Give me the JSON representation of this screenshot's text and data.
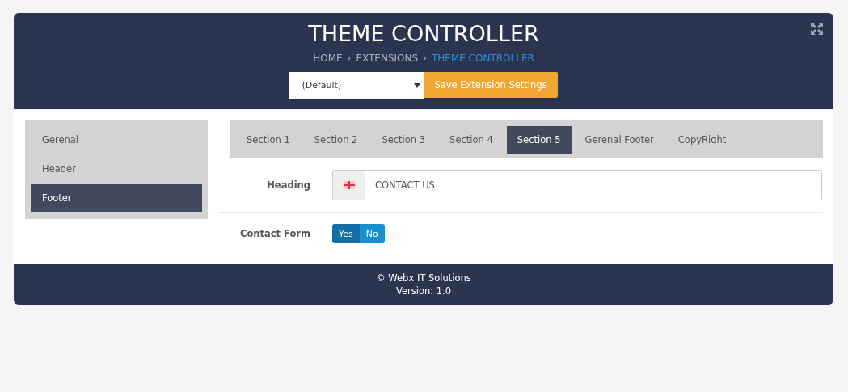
{
  "header": {
    "title": "THEME CONTROLLER",
    "breadcrumb_separator": "›",
    "breadcrumb": [
      {
        "label": "HOME",
        "current": false
      },
      {
        "label": "EXTENSIONS",
        "current": false
      },
      {
        "label": "THEME CONTROLLER",
        "current": true
      }
    ],
    "theme_select": {
      "value": "(Default)"
    },
    "save_button": "Save Extension Settings"
  },
  "sidebar": {
    "items": [
      {
        "label": "Gerenal",
        "selected": false
      },
      {
        "label": "Header",
        "selected": false
      },
      {
        "label": "Footer",
        "selected": true
      }
    ]
  },
  "tabs": [
    {
      "label": "Section 1",
      "selected": false
    },
    {
      "label": "Section 2",
      "selected": false
    },
    {
      "label": "Section 3",
      "selected": false
    },
    {
      "label": "Section 4",
      "selected": false
    },
    {
      "label": "Section 5",
      "selected": true
    },
    {
      "label": "Gerenal Footer",
      "selected": false
    },
    {
      "label": "CopyRight",
      "selected": false
    }
  ],
  "form": [
    {
      "kind": "text",
      "label": "Heading",
      "value": "CONTACT US"
    },
    {
      "kind": "toggle",
      "label": "Contact Form",
      "options": [
        {
          "label": "Yes",
          "selected": true
        },
        {
          "label": "No",
          "selected": false
        }
      ]
    }
  ],
  "footer": {
    "copyright": "© Webx IT Solutions",
    "version": "Version: 1.0"
  }
}
